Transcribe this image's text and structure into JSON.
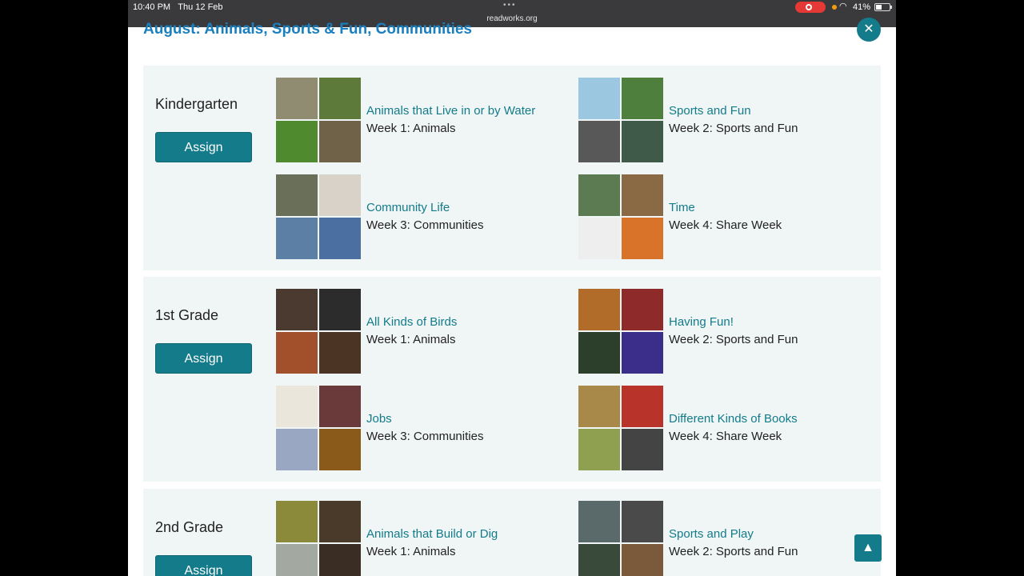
{
  "status_bar": {
    "time": "10:40 PM",
    "date": "Thu 12 Feb",
    "url": "readworks.org",
    "battery": "41%"
  },
  "heading": "August: Animals, Sports & Fun, Communities",
  "close_icon": "✕",
  "scroll_icon": "▲",
  "assign_label": "Assign",
  "sections": [
    {
      "grade": "Kindergarten",
      "units": [
        {
          "title": "Animals that Live in or by Water",
          "week": "Week 1: Animals",
          "colors": [
            "#8f8c72",
            "#5d7a3a",
            "#4f8a2e",
            "#6f6248"
          ]
        },
        {
          "title": "Sports and Fun",
          "week": "Week 2: Sports and Fun",
          "colors": [
            "#9cc7e0",
            "#4e7f3c",
            "#585858",
            "#3f5a48"
          ]
        },
        {
          "title": "Community Life",
          "week": "Week 3: Communities",
          "colors": [
            "#6a6f5a",
            "#d8d2c8",
            "#5b7fa5",
            "#4a6fa0"
          ]
        },
        {
          "title": "Time",
          "week": "Week 4: Share Week",
          "colors": [
            "#5c7b52",
            "#8a6a45",
            "#eeeeee",
            "#d9732a"
          ]
        }
      ]
    },
    {
      "grade": "1st Grade",
      "units": [
        {
          "title": "All Kinds of Birds",
          "week": "Week 1: Animals",
          "colors": [
            "#4a3a30",
            "#2c2c2c",
            "#a2502c",
            "#4b3424"
          ]
        },
        {
          "title": "Having Fun!",
          "week": "Week 2: Sports and Fun",
          "colors": [
            "#b06c28",
            "#8e2a2a",
            "#2b3f2a",
            "#3a2e8a"
          ]
        },
        {
          "title": "Jobs",
          "week": "Week 3: Communities",
          "colors": [
            "#eae6dc",
            "#6a3a3a",
            "#9aa7c2",
            "#8a5a1a"
          ]
        },
        {
          "title": "Different Kinds of Books",
          "week": "Week 4: Share Week",
          "colors": [
            "#a8894a",
            "#b8332a",
            "#8fa050",
            "#444444"
          ]
        }
      ]
    },
    {
      "grade": "2nd Grade",
      "units": [
        {
          "title": "Animals that Build or Dig",
          "week": "Week 1: Animals",
          "colors": [
            "#8a8a3a",
            "#4a3a2a",
            "#a3a8a0",
            "#3a2e24"
          ]
        },
        {
          "title": "Sports and Play",
          "week": "Week 2: Sports and Fun",
          "colors": [
            "#5a6a6a",
            "#4a4a4a",
            "#3a4a3a",
            "#7a5a3a"
          ]
        }
      ]
    }
  ]
}
